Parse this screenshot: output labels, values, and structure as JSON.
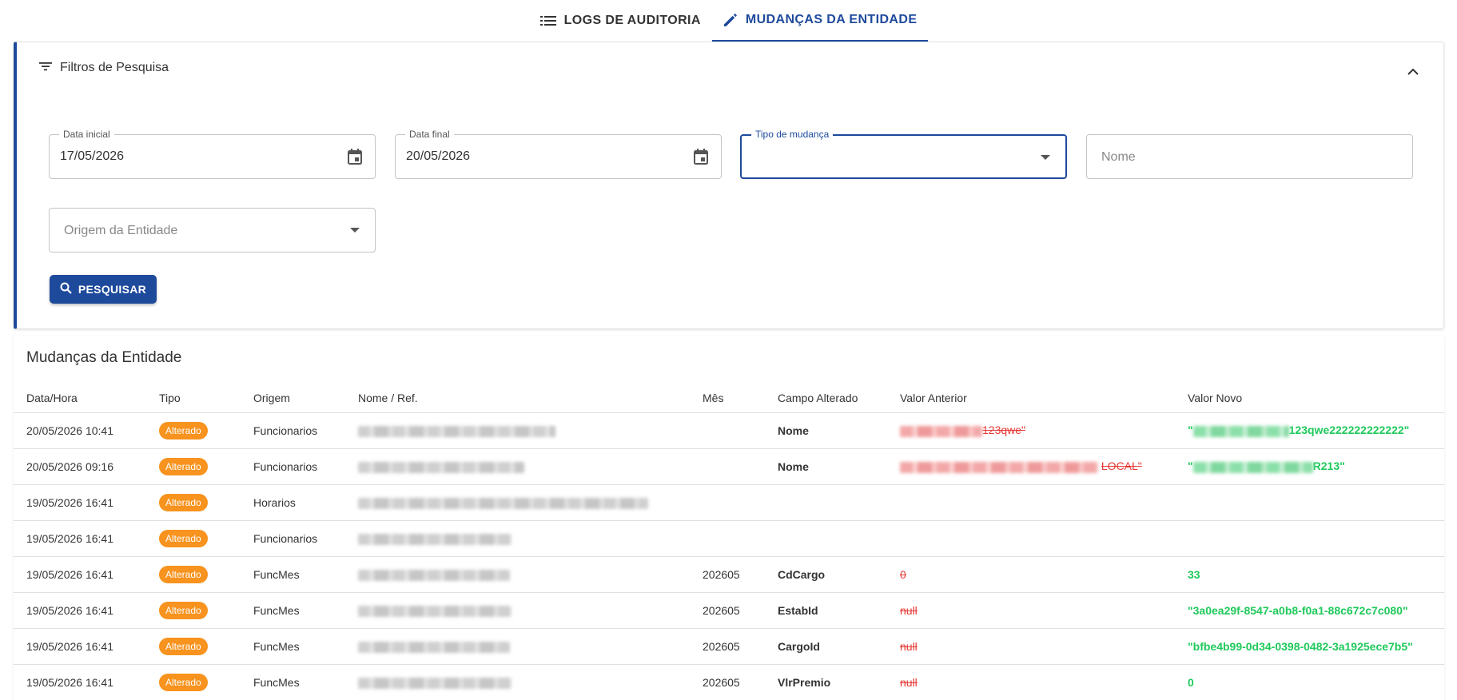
{
  "tabs": [
    {
      "label": "LOGS DE AUDITORIA",
      "icon": "list-icon",
      "active": false
    },
    {
      "label": "MUDANÇAS DA ENTIDADE",
      "icon": "pencil-icon",
      "active": true
    }
  ],
  "filters": {
    "title": "Filtros de Pesquisa",
    "data_inicial": {
      "label": "Data inicial",
      "value": "17/05/2026"
    },
    "data_final": {
      "label": "Data final",
      "value": "20/05/2026"
    },
    "tipo_mudanca": {
      "label": "Tipo de mudança",
      "value": ""
    },
    "nome": {
      "placeholder": "Nome"
    },
    "origem": {
      "placeholder": "Origem da Entidade"
    },
    "search_label": "PESQUISAR"
  },
  "results": {
    "title": "Mudanças da Entidade",
    "columns": [
      "Data/Hora",
      "Tipo",
      "Origem",
      "Nome / Ref.",
      "Mês",
      "Campo Alterado",
      "Valor Anterior",
      "Valor Novo"
    ],
    "rows": [
      {
        "datetime": "20/05/2026 10:41",
        "tipo": "Alterado",
        "origem": "Funcionarios",
        "mes": "",
        "campo": "Nome",
        "anterior": "123qwe\"",
        "novo": "123qwe222222222222\""
      },
      {
        "datetime": "20/05/2026 09:16",
        "tipo": "Alterado",
        "origem": "Funcionarios",
        "mes": "",
        "campo": "Nome",
        "anterior": "LOCAL\"",
        "novo": "R213\""
      },
      {
        "datetime": "19/05/2026 16:41",
        "tipo": "Alterado",
        "origem": "Horarios",
        "mes": "",
        "campo": "",
        "anterior": "",
        "novo": ""
      },
      {
        "datetime": "19/05/2026 16:41",
        "tipo": "Alterado",
        "origem": "Funcionarios",
        "mes": "",
        "campo": "",
        "anterior": "",
        "novo": ""
      },
      {
        "datetime": "19/05/2026 16:41",
        "tipo": "Alterado",
        "origem": "FuncMes",
        "mes": "202605",
        "campo": "CdCargo",
        "anterior": "0",
        "novo": "33"
      },
      {
        "datetime": "19/05/2026 16:41",
        "tipo": "Alterado",
        "origem": "FuncMes",
        "mes": "202605",
        "campo": "EstabId",
        "anterior": "null",
        "novo": "\"3a0ea29f-8547-a0b8-f0a1-88c672c7c080\""
      },
      {
        "datetime": "19/05/2026 16:41",
        "tipo": "Alterado",
        "origem": "FuncMes",
        "mes": "202605",
        "campo": "CargoId",
        "anterior": "null",
        "novo": "\"bfbe4b99-0d34-0398-0482-3a1925ece7b5\""
      },
      {
        "datetime": "19/05/2026 16:41",
        "tipo": "Alterado",
        "origem": "FuncMes",
        "mes": "202605",
        "campo": "VlrPremio",
        "anterior": "null",
        "novo": "0"
      }
    ]
  },
  "colors": {
    "primary": "#1e4a9c",
    "badge": "#f7931e",
    "old": "#e53935",
    "new": "#1ec95a"
  }
}
